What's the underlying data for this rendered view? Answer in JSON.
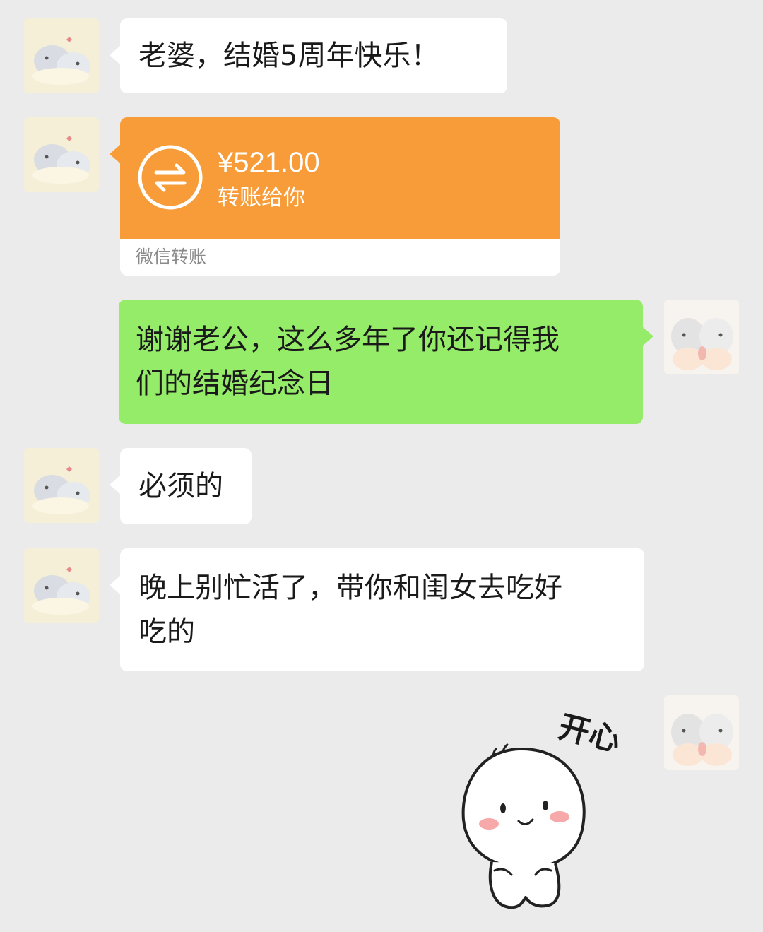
{
  "messages": [
    {
      "side": "in",
      "type": "text",
      "text": "老婆，结婚5周年快乐！"
    },
    {
      "side": "in",
      "type": "transfer",
      "amount": "¥521.00",
      "description": "转账给你",
      "footer": "微信转账",
      "icon": "transfer-arrows-icon"
    },
    {
      "side": "out",
      "type": "text",
      "lines": [
        "谢谢老公，这么多年了你还记得我",
        "们的结婚纪念日"
      ]
    },
    {
      "side": "in",
      "type": "text",
      "text": "必须的"
    },
    {
      "side": "in",
      "type": "text",
      "lines": [
        "晚上别忙活了，带你和闺女去吃好",
        "吃的"
      ]
    },
    {
      "side": "out",
      "type": "sticker",
      "caption": "开心",
      "icon": "smiling-blob-sticker"
    }
  ],
  "colors": {
    "background": "#ebebeb",
    "incoming_bubble": "#ffffff",
    "outgoing_bubble": "#95ec69",
    "transfer": "#f79c38"
  }
}
